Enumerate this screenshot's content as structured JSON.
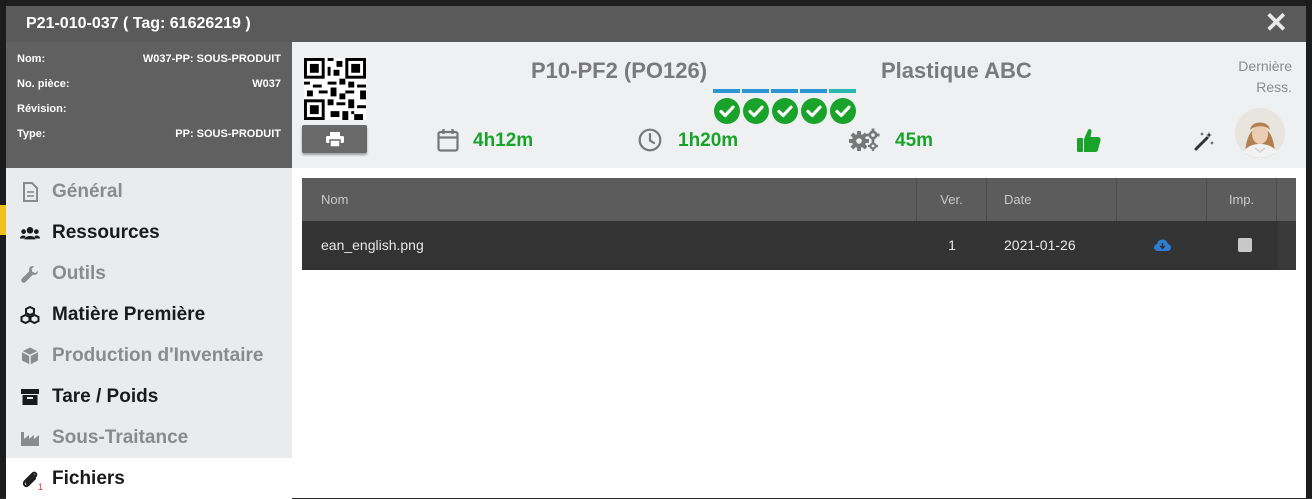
{
  "window": {
    "title": "P21-010-037 ( Tag: 61626219 )",
    "close_glyph": "✕"
  },
  "info": [
    {
      "label": "Nom:",
      "value": "W037-PP: SOUS-PRODUIT"
    },
    {
      "label": "No. pièce:",
      "value": "W037"
    },
    {
      "label": "Révision:",
      "value": ""
    },
    {
      "label": "Type:",
      "value": "PP: SOUS-PRODUIT"
    }
  ],
  "header": {
    "operation": "P10-PF2 (PO126)",
    "client": "Plastique ABC",
    "last_resource_label": "Dernière Ress.",
    "steps_done": 5,
    "step_colors": [
      "#2a97d4",
      "#2a97d4",
      "#2a97d4",
      "#2a97d4",
      "#2ab8b0"
    ],
    "stats": {
      "calendar": "4h12m",
      "clock": "1h20m",
      "gears": "45m"
    },
    "icons": [
      "qr-code-icon",
      "print-icon",
      "calendar-icon",
      "clock-icon",
      "gears-icon",
      "thumbs-up-icon",
      "magic-wand-icon"
    ]
  },
  "sidebar": {
    "items": [
      {
        "label": "Général",
        "icon": "document-icon",
        "style": "light"
      },
      {
        "label": "Ressources",
        "icon": "users-icon",
        "style": "dark"
      },
      {
        "label": "Outils",
        "icon": "wrench-icon",
        "style": "light"
      },
      {
        "label": "Matière Première",
        "icon": "cubes-icon",
        "style": "dark"
      },
      {
        "label": "Production d'Inventaire",
        "icon": "box-icon",
        "style": "light"
      },
      {
        "label": "Tare / Poids",
        "icon": "archive-icon",
        "style": "dark"
      },
      {
        "label": "Sous-Traitance",
        "icon": "industry-icon",
        "style": "light"
      },
      {
        "label": "Fichiers",
        "icon": "paperclip-icon",
        "style": "dark",
        "active": true,
        "badge": "1"
      }
    ]
  },
  "files_table": {
    "columns": [
      "Nom",
      "Ver.",
      "Date",
      "",
      "Imp."
    ],
    "rows": [
      {
        "name": "ean_english.png",
        "version": "1",
        "date": "2021-01-26",
        "download_icon": "cloud-download-icon",
        "imp": false
      }
    ]
  },
  "colors": {
    "accent_green": "#1aa32a",
    "download_blue": "#2a7fd4",
    "title_bar": "#5a5a5a"
  }
}
